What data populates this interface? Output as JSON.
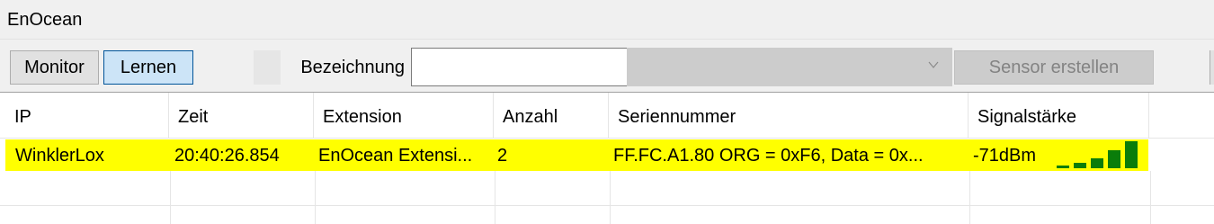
{
  "panel": {
    "title": "EnOcean"
  },
  "toolbar": {
    "monitor_label": "Monitor",
    "lernen_label": "Lernen",
    "bezeichnung_label": "Bezeichnung",
    "bezeichnung_value": "",
    "combo_value": "",
    "sensor_button_label": "Sensor erstellen"
  },
  "table": {
    "columns": [
      "IP",
      "Zeit",
      "Extension",
      "Anzahl",
      "Seriennummer",
      "Signalstärke"
    ],
    "rows": [
      {
        "ip": "WinklerLox",
        "zeit": "20:40:26.854",
        "extension": "EnOcean Extensi...",
        "anzahl": "2",
        "seriennummer": "FF.FC.A1.80 ORG = 0xF6, Data = 0x...",
        "signal": "-71dBm",
        "signal_level": 5,
        "signal_max": 5
      }
    ]
  },
  "colors": {
    "highlight": "#ffff00",
    "signal_bar": "#0a7d0a",
    "disabled_bg": "#cccccc",
    "selected_button": "#cce4f7"
  }
}
